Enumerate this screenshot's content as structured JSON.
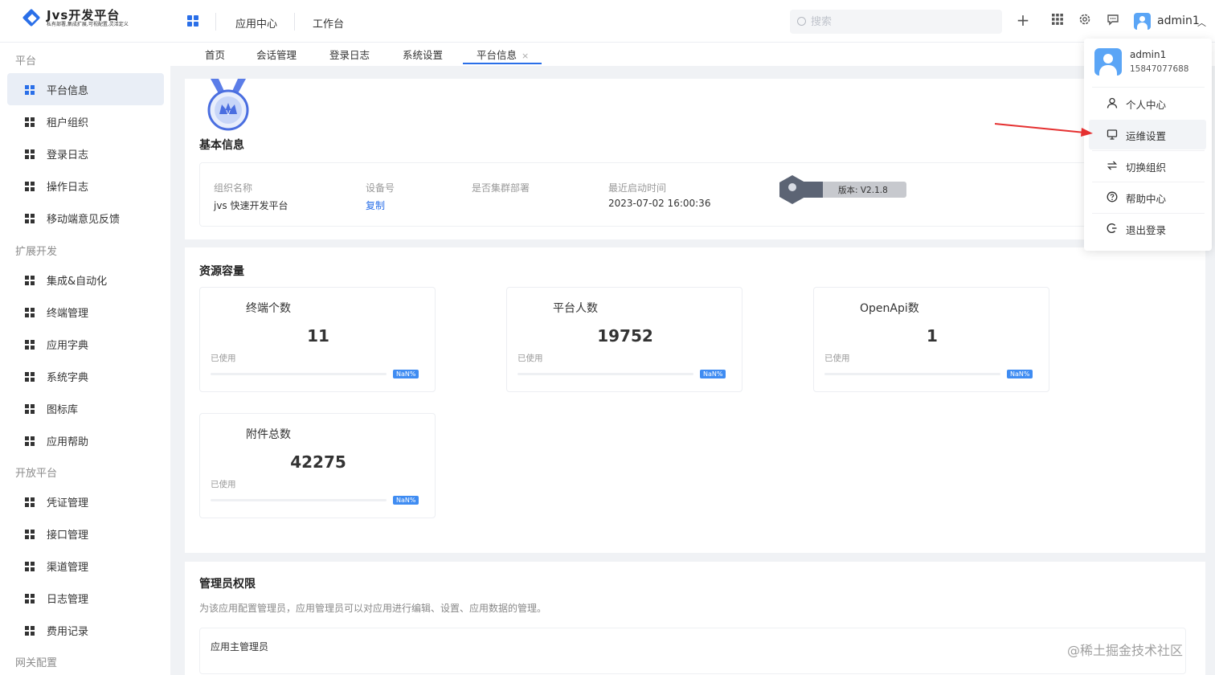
{
  "app": {
    "title": "Jvs开发平台",
    "subtitle": "私有部署,集成扩展,可视配置,灵活定义"
  },
  "header": {
    "nav": [
      "应用中心",
      "工作台"
    ],
    "search_placeholder": "搜索",
    "icons": [
      "plus-icon",
      "apps-grid-icon",
      "gear-icon",
      "message-icon"
    ],
    "user": "admin1"
  },
  "sidebar": {
    "groups": [
      {
        "title": "平台",
        "items": [
          "平台信息",
          "租户组织",
          "登录日志",
          "操作日志",
          "移动端意见反馈"
        ]
      },
      {
        "title": "扩展开发",
        "items": [
          "集成&自动化",
          "终端管理",
          "应用字典",
          "系统字典",
          "图标库",
          "应用帮助"
        ]
      },
      {
        "title": "开放平台",
        "items": [
          "凭证管理",
          "接口管理",
          "渠道管理",
          "日志管理",
          "费用记录"
        ]
      },
      {
        "title": "网关配置",
        "items": []
      }
    ],
    "active": "平台信息"
  },
  "tabs": [
    "首页",
    "会话管理",
    "登录日志",
    "系统设置",
    "平台信息"
  ],
  "active_tab": "平台信息",
  "basic_info": {
    "title": "基本信息",
    "fields": {
      "org_label": "组织名称",
      "org_value": "jvs 快速开发平台",
      "device_label": "设备号",
      "device_value": "复制",
      "cluster_label": "是否集群部署",
      "start_label": "最近启动时间",
      "start_value": "2023-07-02 16:00:36"
    },
    "version": "版本: V2.1.8"
  },
  "resources": {
    "title": "资源容量",
    "used_label": "已使用",
    "cards": [
      {
        "title": "终端个数",
        "value": "11",
        "pct": "NaN%"
      },
      {
        "title": "平台人数",
        "value": "19752",
        "pct": "NaN%"
      },
      {
        "title": "OpenApi数",
        "value": "1",
        "pct": "NaN%"
      },
      {
        "title": "附件总数",
        "value": "42275",
        "pct": "NaN%"
      }
    ]
  },
  "admin": {
    "title": "管理员权限",
    "desc": "为该应用配置管理员，应用管理员可以对应用进行编辑、设置、应用数据的管理。",
    "box_label": "应用主管理员"
  },
  "dropdown": {
    "name": "admin1",
    "phone": "15847077688",
    "items": [
      {
        "label": "个人中心",
        "icon": "user-icon"
      },
      {
        "label": "运维设置",
        "icon": "monitor-icon"
      },
      {
        "label": "切换组织",
        "icon": "switch-icon"
      },
      {
        "label": "帮助中心",
        "icon": "help-icon"
      },
      {
        "label": "退出登录",
        "icon": "logout-icon"
      }
    ]
  },
  "watermark_text": "@稀土掘金技术社区",
  "colors": {
    "accent": "#2a6fe8",
    "arrow": "#e53030"
  }
}
